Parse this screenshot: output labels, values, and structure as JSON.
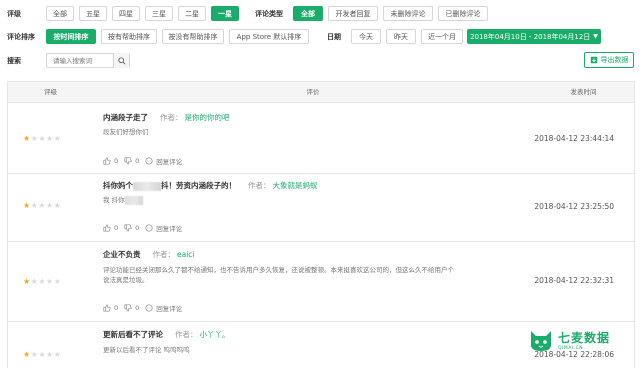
{
  "filters": {
    "rating_label": "评级",
    "rating_options": [
      "全部",
      "五星",
      "四星",
      "三星",
      "二星",
      "一星"
    ],
    "rating_active": "一星",
    "type_label": "评论类型",
    "type_options": [
      "全部",
      "开发者回复",
      "未删除评论",
      "已删除评论"
    ],
    "type_active": "全部",
    "sort_label": "评论排序",
    "sort_options": [
      "按时间排序",
      "按有帮助排序",
      "按没有帮助排序",
      "App Store 默认排序"
    ],
    "sort_active": "按时间排序",
    "date_label": "日期",
    "date_options": [
      "今天",
      "昨天",
      "近一个月"
    ],
    "date_range": "2018年04月10日 - 2018年04月12日",
    "search_label": "搜索",
    "search_placeholder": "请输入搜索词",
    "export_label": "导出数据"
  },
  "table": {
    "col_rating": "评级",
    "col_review": "评价",
    "col_time": "发表时间",
    "author_prefix": "作者：",
    "rows": [
      {
        "title": "内涵段子走了",
        "author": "是你的你的吧",
        "body": "段友们好想你们",
        "stars": 1,
        "likes": "0",
        "dislikes": "0",
        "reply": "回复评论",
        "time": "2018-04-12 23:44:14"
      },
      {
        "title_a": "抖你妈个",
        "title_b": "抖！劳资内涵段子的！",
        "author": "大象就是蚂蚁",
        "body": "我 抖你",
        "stars": 1,
        "likes": "0",
        "dislikes": "0",
        "reply": "回复评论",
        "time": "2018-04-12 23:25:50"
      },
      {
        "title": "企业不负责",
        "author": "eaici",
        "body_line1": "评论功能已经关闭那么久了都不给通知，也不告诉用户多久恢复，还说被整顿。本来挺喜欢这公司的，但这么久不给用户个",
        "body_line2": "说法真是垃圾。",
        "stars": 1,
        "likes": "0",
        "dislikes": "0",
        "reply": "回复评论",
        "time": "2018-04-12 22:32:31"
      },
      {
        "title": "更新后看不了评论",
        "author": "小丫丫。",
        "body": "更新以后看不了评论 呜呜呜呜",
        "stars": 1,
        "time": "2018-04-12 22:28:06"
      }
    ]
  },
  "brand": {
    "name": "七麦数据",
    "sub": "QIMAI.CN",
    "color": "#1aad69"
  },
  "colors": {
    "accent": "#1aad69",
    "star": "#f5a623"
  }
}
